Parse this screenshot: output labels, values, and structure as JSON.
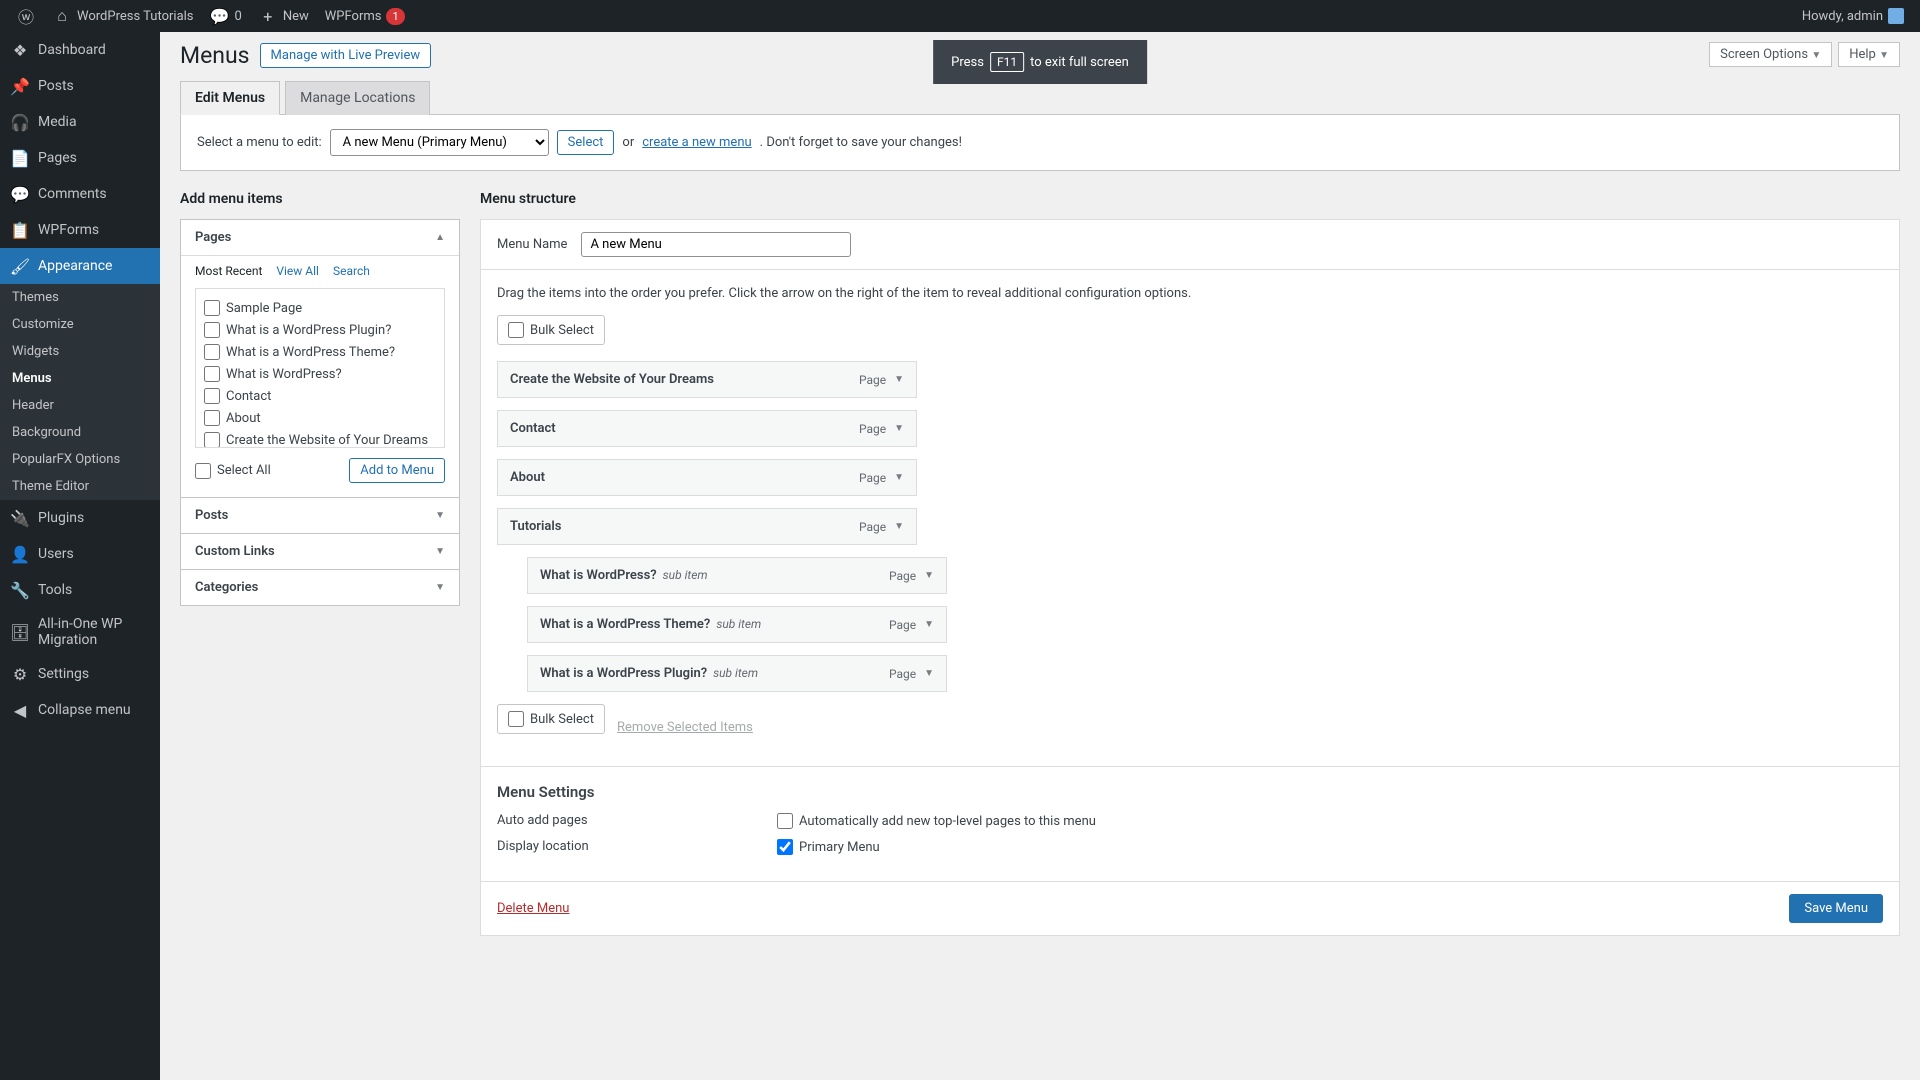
{
  "adminBar": {
    "siteTitle": "WordPress Tutorials",
    "commentCount": "0",
    "newLabel": "New",
    "wpforms": "WPForms",
    "wpformsBadge": "1",
    "howdy": "Howdy, admin"
  },
  "sidebar": {
    "items": [
      {
        "label": "Dashboard",
        "icon": "dashboard"
      },
      {
        "label": "Posts",
        "icon": "pin"
      },
      {
        "label": "Media",
        "icon": "media"
      },
      {
        "label": "Pages",
        "icon": "pages"
      },
      {
        "label": "Comments",
        "icon": "comment"
      },
      {
        "label": "WPForms",
        "icon": "form"
      },
      {
        "label": "Appearance",
        "icon": "brush",
        "current": true
      },
      {
        "label": "Plugins",
        "icon": "plug"
      },
      {
        "label": "Users",
        "icon": "user"
      },
      {
        "label": "Tools",
        "icon": "wrench"
      },
      {
        "label": "All-in-One WP Migration",
        "icon": "migrate"
      },
      {
        "label": "Settings",
        "icon": "settings"
      },
      {
        "label": "Collapse menu",
        "icon": "collapse"
      }
    ],
    "submenu": [
      "Themes",
      "Customize",
      "Widgets",
      "Menus",
      "Header",
      "Background",
      "PopularFX Options",
      "Theme Editor"
    ],
    "activeSub": "Menus"
  },
  "fullscreen": {
    "press": "Press",
    "key": "F11",
    "rest": "to exit full screen"
  },
  "topRight": {
    "screenOptions": "Screen Options",
    "help": "Help"
  },
  "page": {
    "title": "Menus",
    "manageLive": "Manage with Live Preview",
    "tabs": [
      "Edit Menus",
      "Manage Locations"
    ]
  },
  "selectRow": {
    "label": "Select a menu to edit:",
    "selected": "A new Menu (Primary Menu)",
    "selectBtn": "Select",
    "or": "or",
    "createNew": "create a new menu",
    "saveNote": ". Don't forget to save your changes!"
  },
  "addItems": {
    "title": "Add menu items",
    "accordions": [
      "Pages",
      "Posts",
      "Custom Links",
      "Categories"
    ],
    "subTabs": [
      "Most Recent",
      "View All",
      "Search"
    ],
    "pages": [
      "Sample Page",
      "What is a WordPress Plugin?",
      "What is a WordPress Theme?",
      "What is WordPress?",
      "Contact",
      "About",
      "Create the Website of Your Dreams"
    ],
    "selectAll": "Select All",
    "addBtn": "Add to Menu"
  },
  "structure": {
    "title": "Menu structure",
    "nameLabel": "Menu Name",
    "nameValue": "A new Menu",
    "help": "Drag the items into the order you prefer. Click the arrow on the right of the item to reveal additional configuration options.",
    "bulkSelect": "Bulk Select",
    "removeSelected": "Remove Selected Items",
    "items": [
      {
        "label": "Create the Website of Your Dreams",
        "type": "Page",
        "sub": false
      },
      {
        "label": "Contact",
        "type": "Page",
        "sub": false
      },
      {
        "label": "About",
        "type": "Page",
        "sub": false
      },
      {
        "label": "Tutorials",
        "type": "Page",
        "sub": false
      },
      {
        "label": "What is WordPress?",
        "type": "Page",
        "sub": true
      },
      {
        "label": "What is a WordPress Theme?",
        "type": "Page",
        "sub": true
      },
      {
        "label": "What is a WordPress Plugin?",
        "type": "Page",
        "sub": true
      }
    ],
    "subItemLabel": "sub item"
  },
  "settings": {
    "title": "Menu Settings",
    "autoAddLabel": "Auto add pages",
    "autoAddCheck": "Automatically add new top-level pages to this menu",
    "displayLabel": "Display location",
    "primaryMenu": "Primary Menu"
  },
  "footer": {
    "delete": "Delete Menu",
    "save": "Save Menu"
  }
}
